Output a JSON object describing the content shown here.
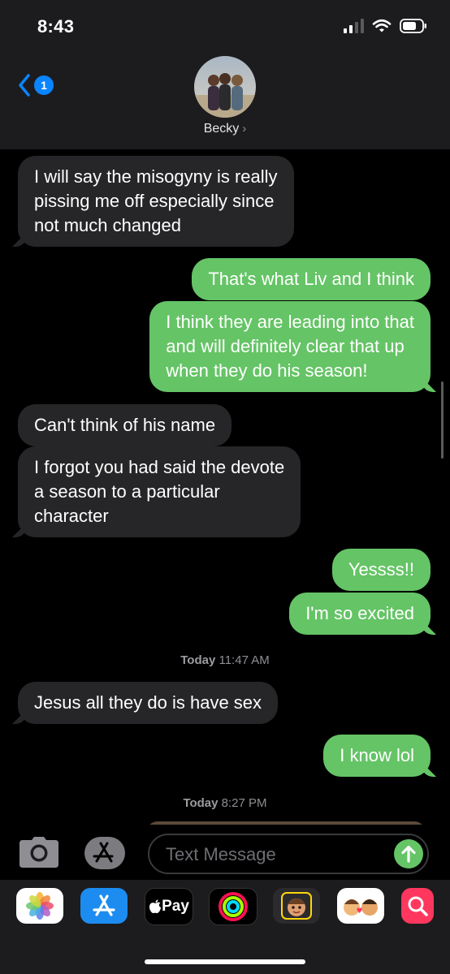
{
  "status_bar": {
    "time": "8:43"
  },
  "header": {
    "back_badge": "1",
    "contact_name": "Becky",
    "chevron": "›"
  },
  "messages": [
    {
      "dir": "in",
      "text": "I will say the misogyny is really\npissing me off especially since\nnot much changed"
    },
    {
      "dir": "out",
      "text": "That's what Liv and I think"
    },
    {
      "dir": "out",
      "text": "I think they are leading into that\nand will definitely clear that up\nwhen they do his season!"
    },
    {
      "dir": "in",
      "text": "Can't think of his name"
    },
    {
      "dir": "in",
      "text": "I forgot you had said the devote\na season to a particular\ncharacter"
    },
    {
      "dir": "out",
      "text": "Yessss!!"
    },
    {
      "dir": "out",
      "text": "I'm so excited"
    },
    {
      "dir": "in",
      "text": "Jesus all they do is have sex"
    },
    {
      "dir": "out",
      "text": "I know lol"
    }
  ],
  "timestamps": [
    {
      "day": "Today",
      "time": "11:47 AM"
    },
    {
      "day": "Today",
      "time": "8:27 PM"
    }
  ],
  "input": {
    "placeholder": "Text Message"
  },
  "app_drawer": [
    {
      "icon": "photos-icon"
    },
    {
      "icon": "app-store-icon"
    },
    {
      "icon": "apple-pay-icon",
      "label": "Pay"
    },
    {
      "icon": "activity-icon"
    },
    {
      "icon": "memoji-icon"
    },
    {
      "icon": "memoji-stickers-icon"
    },
    {
      "icon": "web-images-search-icon"
    }
  ],
  "colors": {
    "incoming_bubble": "#262628",
    "outgoing_bubble": "#65c466",
    "accent": "#0a84ff"
  }
}
